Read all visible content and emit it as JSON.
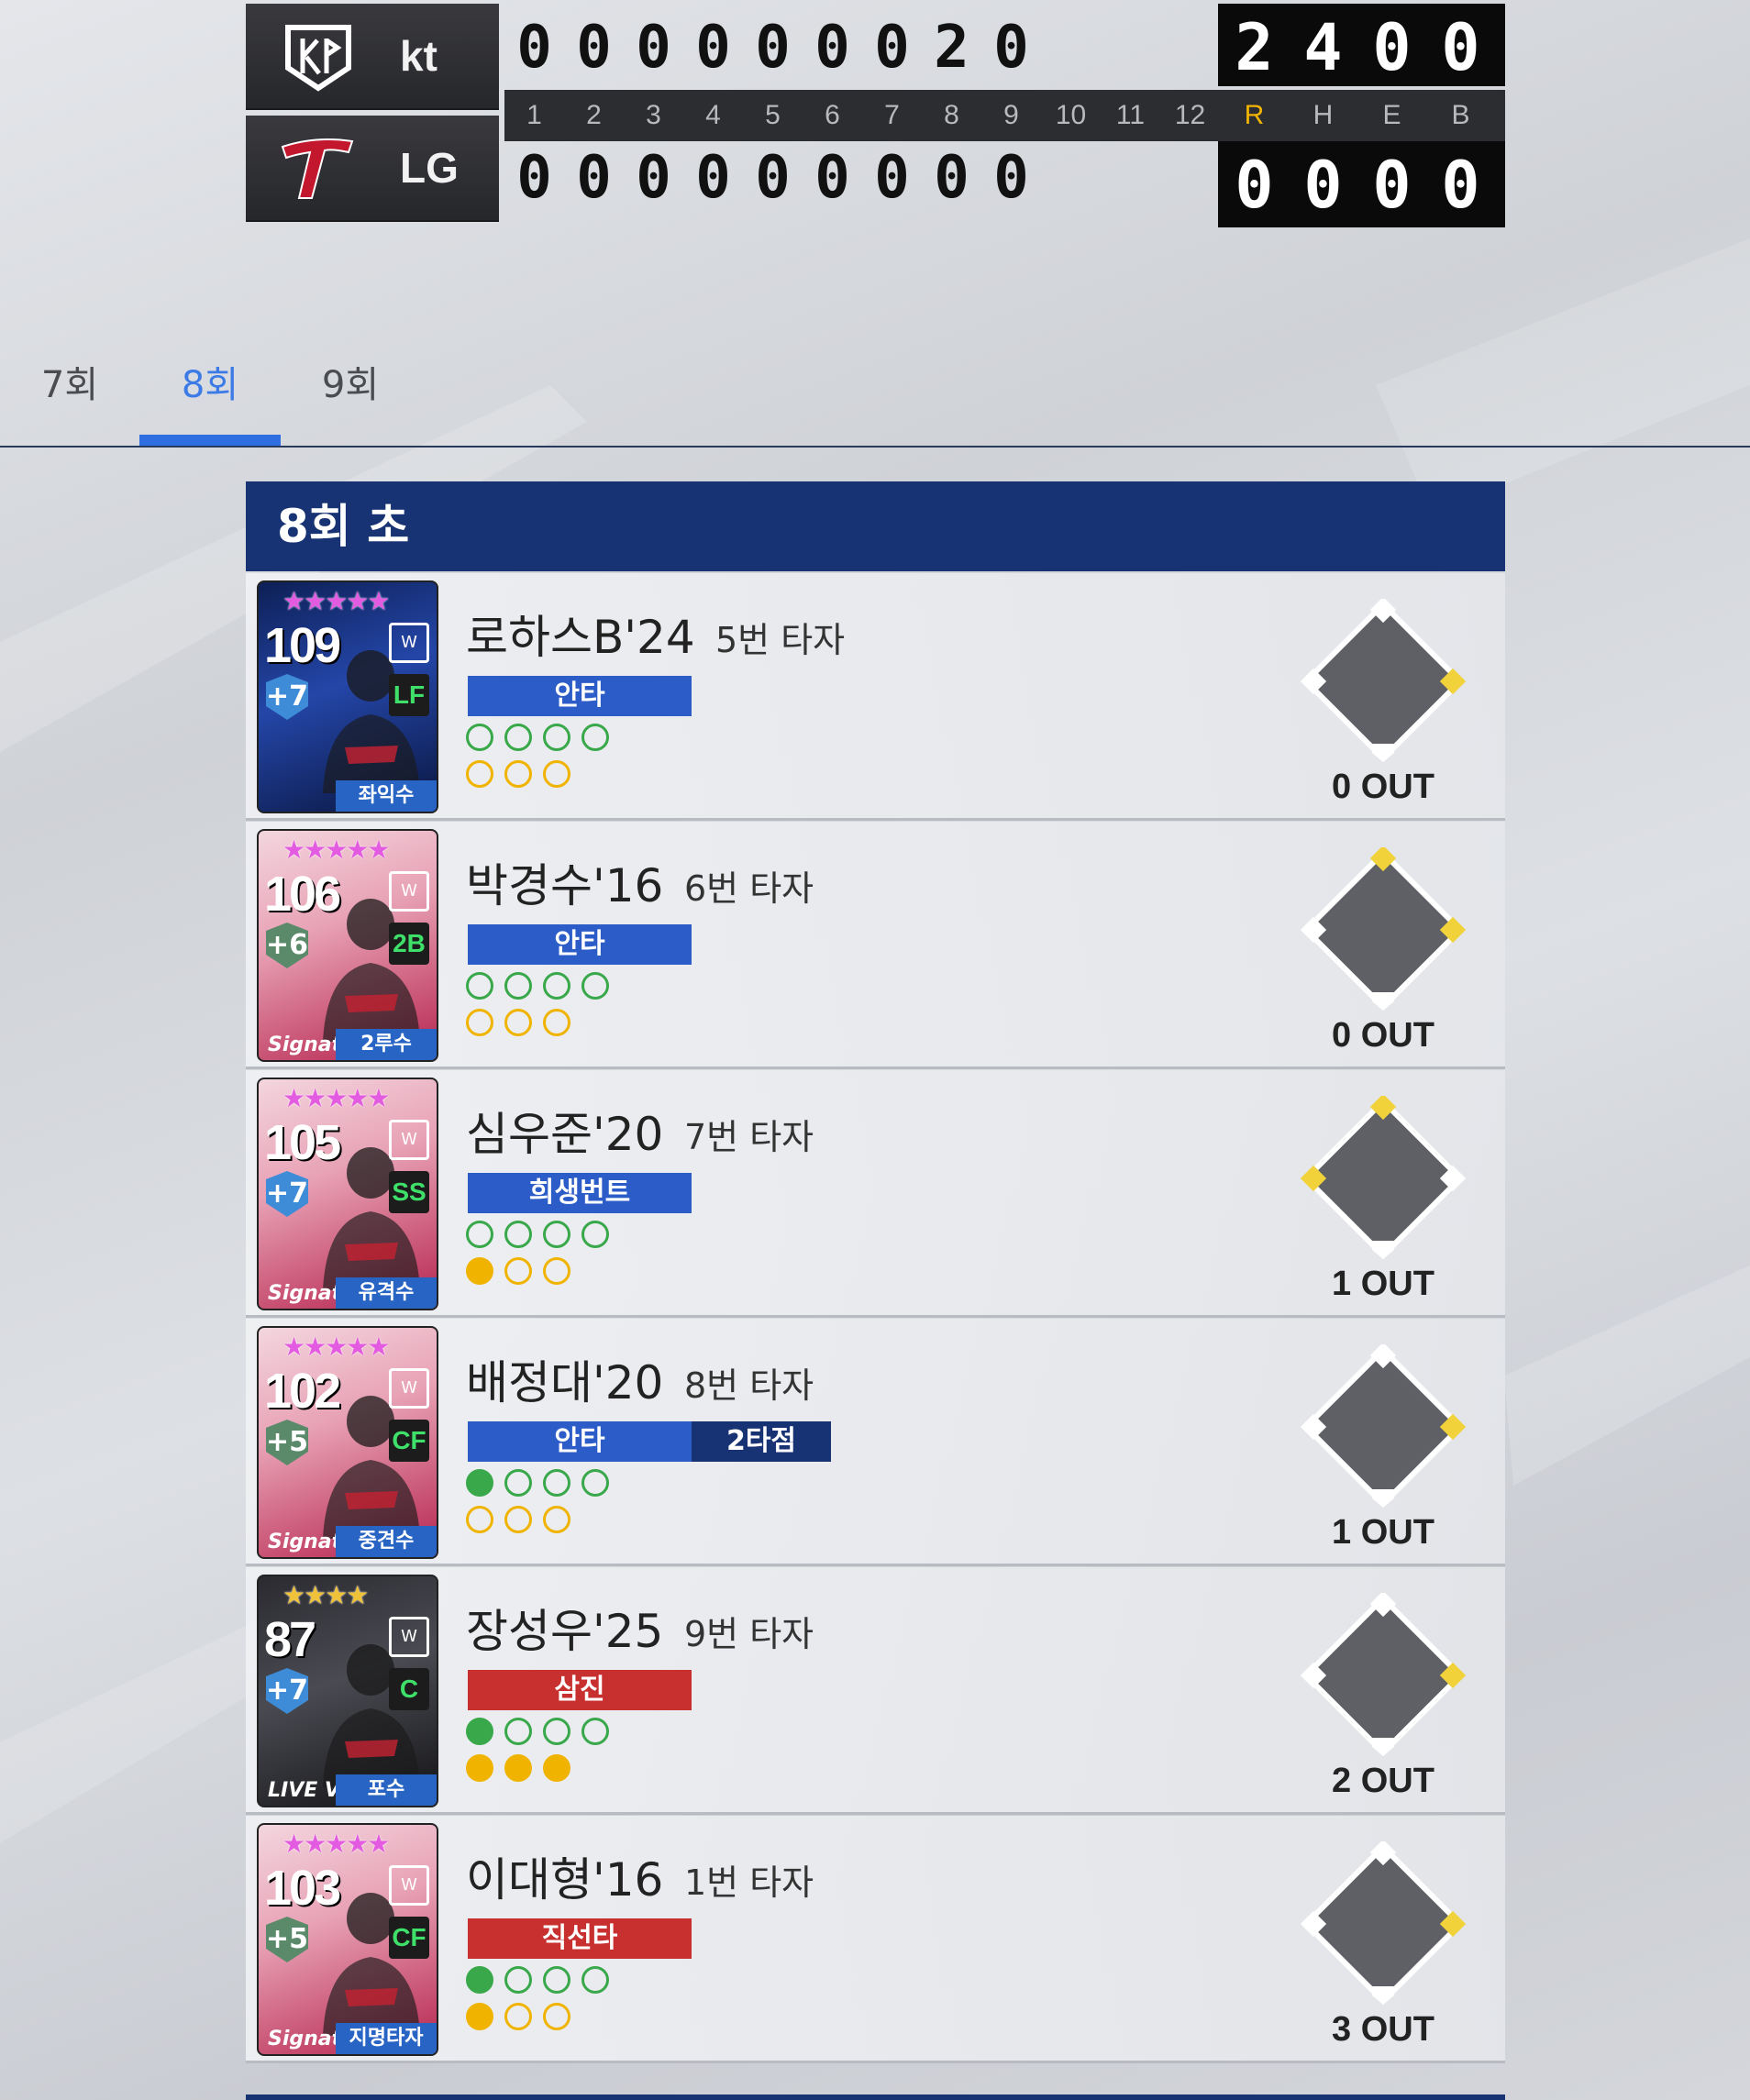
{
  "scoreboard": {
    "away": {
      "name": "kt",
      "innings": [
        "0",
        "0",
        "0",
        "0",
        "0",
        "0",
        "0",
        "2",
        "0"
      ],
      "rheb": [
        "2",
        "4",
        "0",
        "0"
      ]
    },
    "home": {
      "name": "LG",
      "innings": [
        "0",
        "0",
        "0",
        "0",
        "0",
        "0",
        "0",
        "0",
        "0"
      ],
      "rheb": [
        "0",
        "0",
        "0",
        "0"
      ]
    },
    "inning_labels": [
      "1",
      "2",
      "3",
      "4",
      "5",
      "6",
      "7",
      "8",
      "9",
      "10",
      "11",
      "12"
    ],
    "rheb_labels": [
      "R",
      "H",
      "E",
      "B"
    ],
    "colors": {
      "run_label": "#f0b400"
    }
  },
  "tabs": [
    {
      "label": "7회"
    },
    {
      "label": "8회",
      "active": true
    },
    {
      "label": "9회"
    }
  ],
  "half_inning": {
    "title": "8회 초",
    "plate_appearances": [
      {
        "name": "로하스B'24",
        "order": "5번 타자",
        "result": "안타",
        "result_color": "blue",
        "rbi": "",
        "card": {
          "ovr": "109",
          "plus": "+7",
          "pos": "LF",
          "posname": "좌익수",
          "tag": "",
          "stars": "★★★★★",
          "star_color": "pink",
          "bg": "blue"
        },
        "balls": [
          0,
          0,
          0,
          0
        ],
        "strikes": [
          0,
          0,
          0
        ],
        "bases": {
          "first": true,
          "second": false,
          "third": false
        },
        "outs": "0 OUT"
      },
      {
        "name": "박경수'16",
        "order": "6번 타자",
        "result": "안타",
        "result_color": "blue",
        "rbi": "",
        "card": {
          "ovr": "106",
          "plus": "+6",
          "pos": "2B",
          "posname": "2루수",
          "tag": "Signature",
          "stars": "★★★★★",
          "star_color": "pink",
          "bg": "pink"
        },
        "balls": [
          0,
          0,
          0,
          0
        ],
        "strikes": [
          0,
          0,
          0
        ],
        "bases": {
          "first": true,
          "second": true,
          "third": false
        },
        "outs": "0 OUT"
      },
      {
        "name": "심우준'20",
        "order": "7번 타자",
        "result": "희생번트",
        "result_color": "blue",
        "rbi": "",
        "card": {
          "ovr": "105",
          "plus": "+7",
          "pos": "SS",
          "posname": "유격수",
          "tag": "Signature",
          "stars": "★★★★★",
          "star_color": "pink",
          "bg": "pink"
        },
        "balls": [
          0,
          0,
          0,
          0
        ],
        "strikes": [
          1,
          0,
          0
        ],
        "bases": {
          "first": false,
          "second": true,
          "third": true
        },
        "outs": "1 OUT"
      },
      {
        "name": "배정대'20",
        "order": "8번 타자",
        "result": "안타",
        "result_color": "blue",
        "rbi": "2타점",
        "card": {
          "ovr": "102",
          "plus": "+5",
          "pos": "CF",
          "posname": "중견수",
          "tag": "Signature",
          "stars": "★★★★★",
          "star_color": "pink",
          "bg": "pink"
        },
        "balls": [
          1,
          0,
          0,
          0
        ],
        "strikes": [
          0,
          0,
          0
        ],
        "bases": {
          "first": true,
          "second": false,
          "third": false
        },
        "outs": "1 OUT"
      },
      {
        "name": "장성우'25",
        "order": "9번 타자",
        "result": "삼진",
        "result_color": "red",
        "rbi": "",
        "card": {
          "ovr": "87",
          "plus": "+7",
          "pos": "C",
          "posname": "포수",
          "tag": "LIVE V3",
          "stars": "★★★★",
          "star_color": "gold",
          "bg": "dark"
        },
        "balls": [
          1,
          0,
          0,
          0
        ],
        "strikes": [
          1,
          1,
          1
        ],
        "bases": {
          "first": true,
          "second": false,
          "third": false
        },
        "outs": "2 OUT"
      },
      {
        "name": "이대형'16",
        "order": "1번 타자",
        "result": "직선타",
        "result_color": "red",
        "rbi": "",
        "card": {
          "ovr": "103",
          "plus": "+5",
          "pos": "CF",
          "posname": "지명타자",
          "tag": "Signature",
          "stars": "★★★★★",
          "star_color": "pink",
          "bg": "pink"
        },
        "balls": [
          1,
          0,
          0,
          0
        ],
        "strikes": [
          1,
          0,
          0
        ],
        "bases": {
          "first": true,
          "second": false,
          "third": false
        },
        "outs": "3 OUT"
      }
    ]
  }
}
